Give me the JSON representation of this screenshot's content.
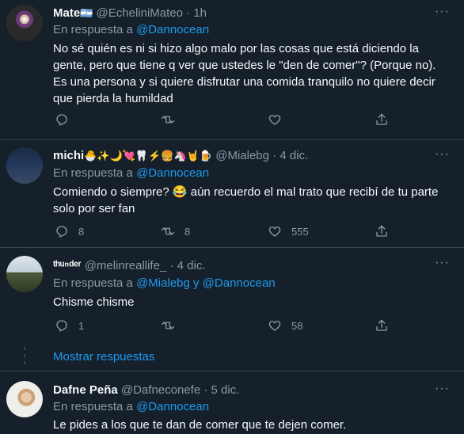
{
  "tweets": [
    {
      "name": "Mate",
      "name_emoji": "🇦🇷",
      "handle": "@EcheliniMateo",
      "time": "1h",
      "reply_prefix": "En respuesta a ",
      "reply_to": "@Dannocean",
      "text": "No sé quién es ni si hizo algo malo por las cosas que está diciendo la gente, pero que tiene q ver que ustedes le \"den de comer\"? (Porque no). Es una persona y si quiere disfrutar una comida tranquilo no quiere decir que pierda la humildad",
      "replies": "",
      "retweets": "",
      "likes": ""
    },
    {
      "name": "michi",
      "name_emoji": "🐣✨🌙💘🦷⚡🍔🦄🤘🍺",
      "handle": "@Mialebg",
      "time": "4 dic.",
      "reply_prefix": "En respuesta a ",
      "reply_to": "@Dannocean",
      "text": "Comiendo o siempre? 😂 aún recuerdo el mal trato que recibí de tu parte solo por ser fan",
      "replies": "8",
      "retweets": "8",
      "likes": "555"
    },
    {
      "name": "ᵗʰᵘⁿᵈᵉʳ",
      "name_emoji": "",
      "handle": "@melinreallife_",
      "time": "4 dic.",
      "reply_prefix": "En respuesta a ",
      "reply_to": "@Mialebg y @Dannocean",
      "text": "Chisme chisme",
      "replies": "1",
      "retweets": "",
      "likes": "58"
    },
    {
      "name": "Dafne Peña",
      "name_emoji": "",
      "handle": "@Dafneconefe",
      "time": "5 dic.",
      "reply_prefix": "En respuesta a ",
      "reply_to": "@Dannocean",
      "text": "Le pides a los que te dan de comer que te dejen comer."
    }
  ],
  "show_replies": "Mostrar respuestas",
  "more_glyph": "···",
  "dot": "·",
  "colors": {
    "background": "#15202b",
    "link": "#1d9bf0",
    "muted": "#8b98a5",
    "divider": "#38444d"
  },
  "icons": [
    "reply-icon",
    "retweet-icon",
    "like-icon",
    "share-icon",
    "more-icon"
  ]
}
